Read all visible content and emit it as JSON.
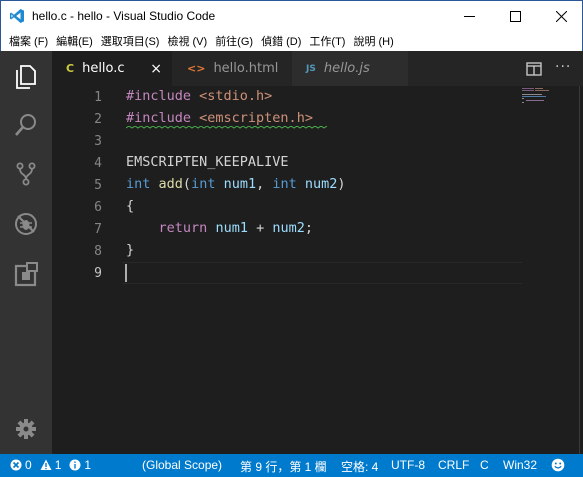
{
  "window": {
    "title": "hello.c - hello - Visual Studio Code"
  },
  "menu": [
    "檔案 (F)",
    "編輯(E)",
    "選取項目(S)",
    "檢視 (V)",
    "前往(G)",
    "偵錯 (D)",
    "工作(T)",
    "說明 (H)"
  ],
  "activity_bar": {
    "items": [
      "explorer-icon",
      "search-icon",
      "source-control-icon",
      "debug-icon",
      "extensions-icon"
    ],
    "bottom": "gear-icon"
  },
  "tabs": [
    {
      "icon": "C",
      "label": "hello.c",
      "close": "×",
      "active": true,
      "icon_color": "#cbcb41"
    },
    {
      "icon": "<>",
      "label": "hello.html",
      "active": false,
      "icon_color": "#e37933"
    },
    {
      "icon": "JS",
      "label": "hello.js",
      "active": false,
      "icon_color": "#519aba"
    }
  ],
  "editor": {
    "line_numbers": [
      "1",
      "2",
      "3",
      "4",
      "5",
      "6",
      "7",
      "8",
      "9"
    ],
    "lines": [
      [
        {
          "t": "#include ",
          "c": "kw-pp"
        },
        {
          "t": "<stdio.h>",
          "c": "kw-str"
        }
      ],
      [
        {
          "t": "#include ",
          "c": "kw-pp"
        },
        {
          "t": "<emscripten.h>",
          "c": "kw-str"
        }
      ],
      [],
      [
        {
          "t": "EMSCRIPTEN_KEEPALIVE",
          "c": ""
        }
      ],
      [
        {
          "t": "int",
          "c": "kw-type"
        },
        {
          "t": " ",
          "c": ""
        },
        {
          "t": "add",
          "c": "kw-fn"
        },
        {
          "t": "(",
          "c": ""
        },
        {
          "t": "int",
          "c": "kw-type"
        },
        {
          "t": " ",
          "c": ""
        },
        {
          "t": "num1",
          "c": "kw-var"
        },
        {
          "t": ", ",
          "c": ""
        },
        {
          "t": "int",
          "c": "kw-type"
        },
        {
          "t": " ",
          "c": ""
        },
        {
          "t": "num2",
          "c": "kw-var"
        },
        {
          "t": ")",
          "c": ""
        }
      ],
      [
        {
          "t": "{",
          "c": ""
        }
      ],
      [
        {
          "t": "    ",
          "c": ""
        },
        {
          "t": "return",
          "c": "kw-pp"
        },
        {
          "t": " ",
          "c": ""
        },
        {
          "t": "num1",
          "c": "kw-var"
        },
        {
          "t": " + ",
          "c": ""
        },
        {
          "t": "num2",
          "c": "kw-var"
        },
        {
          "t": ";",
          "c": ""
        }
      ],
      [
        {
          "t": "}",
          "c": ""
        }
      ],
      []
    ]
  },
  "status_bar": {
    "errors": "0",
    "warnings": "1",
    "info": "1",
    "scope": "(Global Scope)",
    "position": "第 9 行，第 1 欄",
    "spaces": "空格: 4",
    "encoding": "UTF-8",
    "eol": "CRLF",
    "language": "C",
    "platform": "Win32",
    "feedback": "smiley-icon"
  },
  "colors": {
    "statusbar": "#007acc",
    "activitybar": "#333333",
    "editor_bg": "#1e1e1e",
    "tabbar_bg": "#252526"
  }
}
